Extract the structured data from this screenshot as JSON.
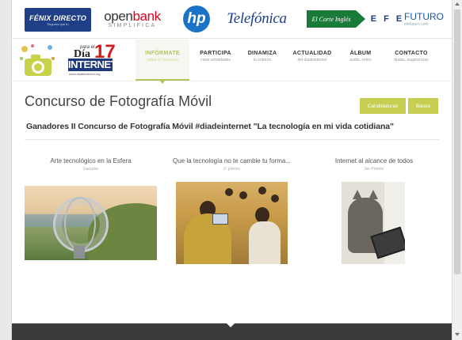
{
  "sponsors": {
    "fenix": {
      "name": "FÉNIX DIRECTO",
      "tagline": "Seguros que tú"
    },
    "openbank": {
      "name_a": "open",
      "name_b": "bank",
      "tagline": "SIMPLIFICA"
    },
    "hp": {
      "name": "hp"
    },
    "telefonica": {
      "name": "Telefónica"
    },
    "corteingles": {
      "name": "El Corte Inglés"
    },
    "efe": {
      "name": "E F E",
      "box": "E:"
    },
    "efefuturo": {
      "name": "FUTURO",
      "url": "efefuturo.com"
    }
  },
  "logo": {
    "para": "para el",
    "dia": "Día",
    "num": "17",
    "internet": "INTERNET",
    "url": "www.diadeinternet.org"
  },
  "nav": {
    "items": [
      {
        "label": "INFÓRMATE",
        "sub": "sobre el concurso",
        "active": true
      },
      {
        "label": "PARTICIPA",
        "sub": "crear actividades"
      },
      {
        "label": "DINAMIZA",
        "sub": "tu entorno"
      },
      {
        "label": "ACTUALIDAD",
        "sub": "del diadeinternet"
      },
      {
        "label": "ÁLBUM",
        "sub": "audio, vídeo"
      },
      {
        "label": "CONTACTO",
        "sub": "dudas, sugerencias"
      }
    ]
  },
  "page": {
    "title": "Concurso de Fotografía Móvil",
    "buttons": {
      "candidaturas": "Candidaturas",
      "bases": "Bases"
    },
    "heading": "Ganadores II Concurso de Fotografía Móvil #diadeinternet \"La tecnología en mi vida cotidiana\""
  },
  "gallery": [
    {
      "caption": "Arte tecnológico en la Esfera",
      "sub": "Ganador"
    },
    {
      "caption": "Que la tecnología no te cambie tu forma...",
      "sub": "2º premio"
    },
    {
      "caption": "Internet al alcance de todos",
      "sub": "3er Premio"
    }
  ],
  "colors": {
    "accent": "#c6cf52",
    "footer": "#3a3a3a",
    "brand_blue": "#1f3a7c"
  }
}
